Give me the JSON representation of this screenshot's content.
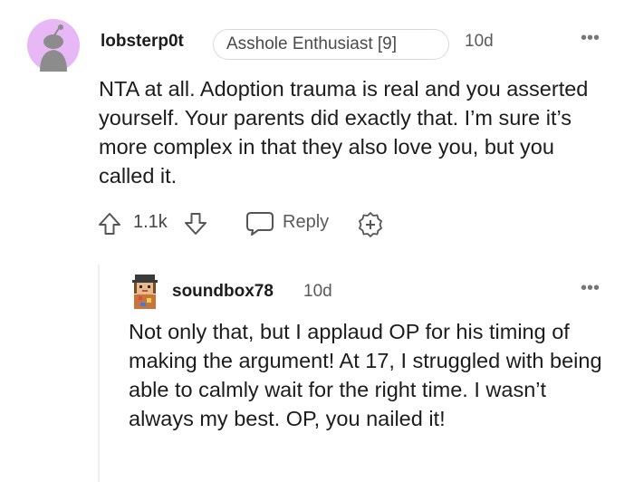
{
  "comment": {
    "username": "lobsterp0t",
    "flair": "Asshole Enthusiast [9]",
    "time": "10d",
    "more_label": "•••",
    "body": "NTA at all. Adoption trauma is real and you asserted yourself. Your parents did exactly that. I’m sure it’s more complex in that they also love you, but you called it.",
    "votes": "1.1k",
    "reply_label": "Reply",
    "icons": {
      "avatar": "snoo-avatar-icon",
      "upvote": "upvote-arrow-icon",
      "downvote": "downvote-arrow-icon",
      "reply": "speech-bubble-icon",
      "award": "award-plus-icon"
    },
    "colors": {
      "avatar_bg": "#e7b8f5"
    }
  },
  "reply": {
    "username": "soundbox78",
    "time": "10d",
    "more_label": "•••",
    "body": "Not only that, but I applaud OP for his timing of making the argument! At 17, I struggled with being able to calmly wait for the right time. I wasn’t always my best. OP, you nailed it!",
    "icons": {
      "avatar": "pixel-character-avatar-icon"
    }
  }
}
